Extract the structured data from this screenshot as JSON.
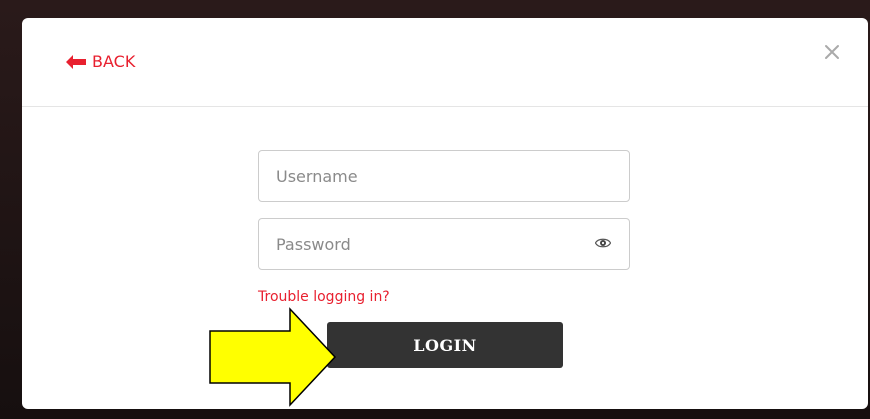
{
  "modal": {
    "back_label": "BACK",
    "close_label": "×"
  },
  "form": {
    "username_placeholder": "Username",
    "password_placeholder": "Password",
    "trouble_link": "Trouble logging in?",
    "login_label": "LOGIN"
  },
  "icons": {
    "back": "arrow-left-icon",
    "close": "close-icon",
    "reveal": "eye-icon",
    "annotation": "yellow-arrow-icon"
  },
  "colors": {
    "accent": "#e8202f",
    "button": "#333333",
    "annotation": "#ffff00"
  }
}
